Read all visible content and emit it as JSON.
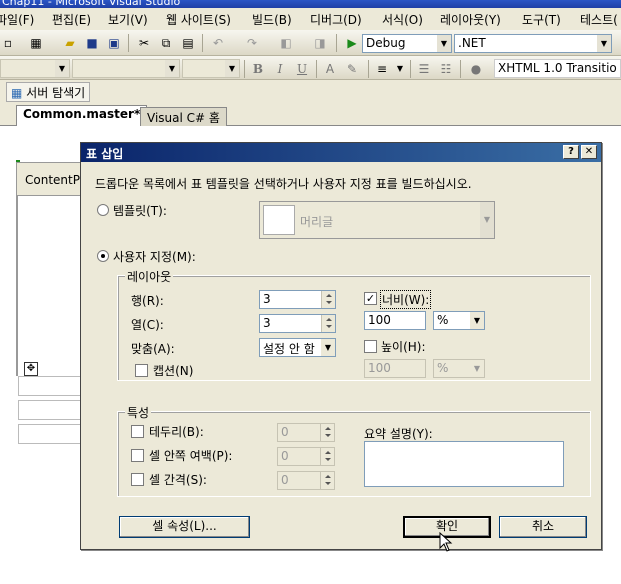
{
  "window": {
    "title": "Chap11 - Microsoft Visual Studio"
  },
  "menu": [
    "파일(F)",
    "편집(E)",
    "보기(V)",
    "웹 사이트(S)",
    "빌드(B)",
    "디버그(D)",
    "서식(O)",
    "레이아웃(Y)",
    "도구(T)",
    "테스트("
  ],
  "toolbar": {
    "config": "Debug",
    "platform": ".NET",
    "doctype": "XHTML 1.0 Transitio"
  },
  "explorer": {
    "label": "서버 탐색기"
  },
  "tabs": [
    {
      "label": "Common.master*"
    },
    {
      "label": "Visual C# 홈"
    }
  ],
  "editor": {
    "content_placeholder": "ContentP"
  },
  "dialog": {
    "title": "표 삽입",
    "instruction": "드롭다운 목록에서 표 템플릿을 선택하거나 사용자 지정 표를 빌드하십시오.",
    "template_radio": "템플릿(T):",
    "template_value": "머리글",
    "custom_radio": "사용자 지정(M):",
    "layout": {
      "title": "레이아웃",
      "rows_label": "행(R):",
      "rows_value": "3",
      "cols_label": "열(C):",
      "cols_value": "3",
      "align_label": "맞춤(A):",
      "align_value": "설정 안 함",
      "caption_label": "캡션(N)",
      "width_label": "너비(W):",
      "width_value": "100",
      "width_unit": "%",
      "height_label": "높이(H):",
      "height_value": "100",
      "height_unit": "%"
    },
    "attributes": {
      "title": "특성",
      "border_label": "테두리(B):",
      "border_value": "0",
      "padding_label": "셀 안쪽 여백(P):",
      "padding_value": "0",
      "spacing_label": "셀 간격(S):",
      "spacing_value": "0",
      "summary_label": "요약 설명(Y):"
    },
    "buttons": {
      "cell_props": "셀 속성(L)...",
      "ok": "확인",
      "cancel": "취소"
    }
  }
}
